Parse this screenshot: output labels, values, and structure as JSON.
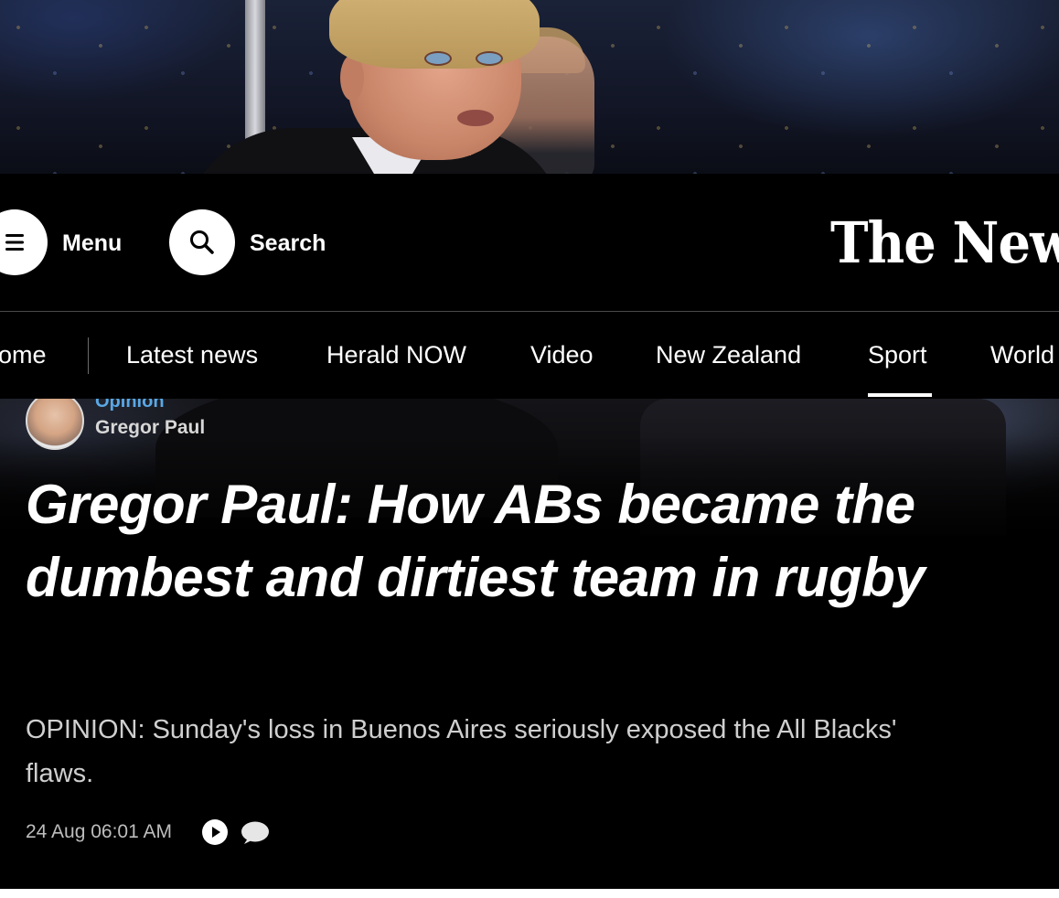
{
  "header": {
    "menu_label": "Menu",
    "search_label": "Search",
    "logo_text": "The New Z"
  },
  "nav": {
    "items": [
      "ome",
      "Latest news",
      "Herald NOW",
      "Video",
      "New Zealand",
      "Sport",
      "World"
    ],
    "active": "Sport"
  },
  "article": {
    "section": "Opinion",
    "author": "Gregor Paul",
    "headline": "Gregor Paul: How ABs became the dumbest and dirtiest team in rugby",
    "standfirst": "OPINION: Sunday's loss in Buenos Aires seriously exposed the All Blacks' flaws.",
    "timestamp": "24 Aug 06:01 AM"
  },
  "icons": {
    "menu": "hamburger-icon",
    "search": "search-icon",
    "play": "play-icon",
    "comments": "comment-icon"
  },
  "colors": {
    "background": "#000000",
    "text": "#ffffff",
    "section_accent": "#5aa8e6"
  }
}
